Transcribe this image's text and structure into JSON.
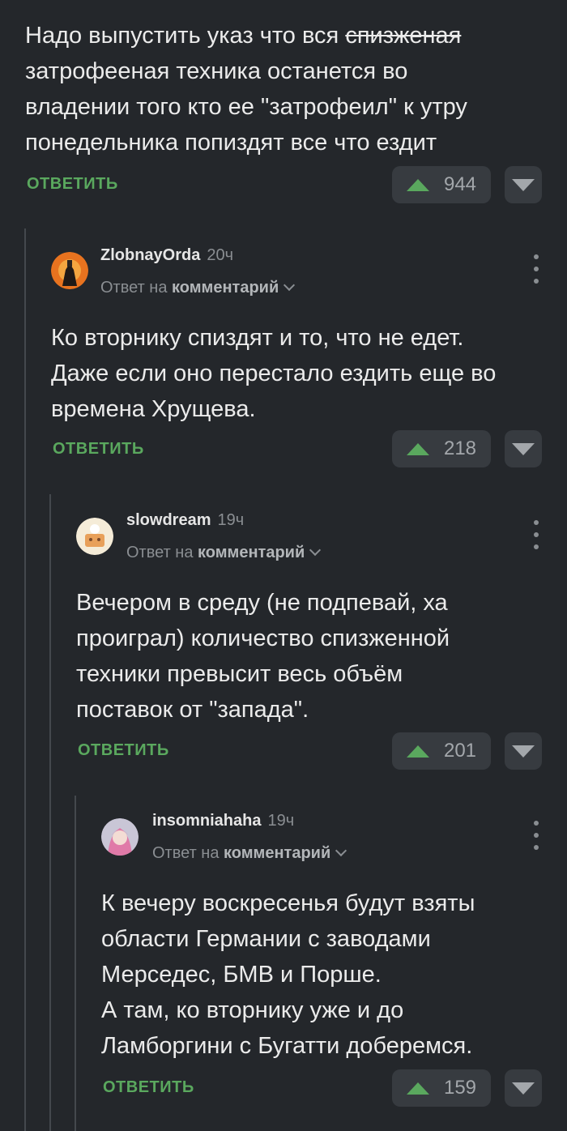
{
  "comments": [
    {
      "text_before": "Надо выпустить указ что вся ",
      "text_strike": "спизженая",
      "text_after": "\nзатрофееная техника останется во\nвладении того кто ее \"затрофеил\" к утру\nпонедельника попиздят все что ездит",
      "reply_label": "ОТВЕТИТЬ",
      "votes": "944"
    },
    {
      "username": "ZlobnayOrda",
      "time": "20ч",
      "reply_prefix": "Ответ на",
      "reply_target": "комментарий",
      "text": "Ко вторнику спиздят и то, что не едет.\nДаже если оно перестало ездить еще во\nвремена Хрущева.",
      "reply_label": "ОТВЕТИТЬ",
      "votes": "218"
    },
    {
      "username": "slowdream",
      "time": "19ч",
      "reply_prefix": "Ответ на",
      "reply_target": "комментарий",
      "text": "Вечером в среду (не подпевай, ха\nпроиграл) количество спизженной\nтехники превысит весь объём\nпоставок от \"запада\".",
      "reply_label": "ОТВЕТИТЬ",
      "votes": "201"
    },
    {
      "username": "insomniahaha",
      "time": "19ч",
      "reply_prefix": "Ответ на",
      "reply_target": "комментарий",
      "text": "К вечеру воскресенья будут взяты\nобласти Германии с заводами\nМерседес, БМВ и Порше.\nА там, ко вторнику уже и до\nЛамборгини с Бугатти доберемся.",
      "reply_label": "ОТВЕТИТЬ",
      "votes": "159"
    }
  ],
  "colors": {
    "background": "#24272b",
    "accent_green": "#5aa85e",
    "vote_box": "#373b40",
    "muted": "#8a8e92"
  },
  "icons": {
    "upvote": "upvote-arrow-icon",
    "downvote": "downvote-arrow-icon",
    "menu": "more-vertical-icon",
    "chevron": "chevron-down-icon"
  }
}
